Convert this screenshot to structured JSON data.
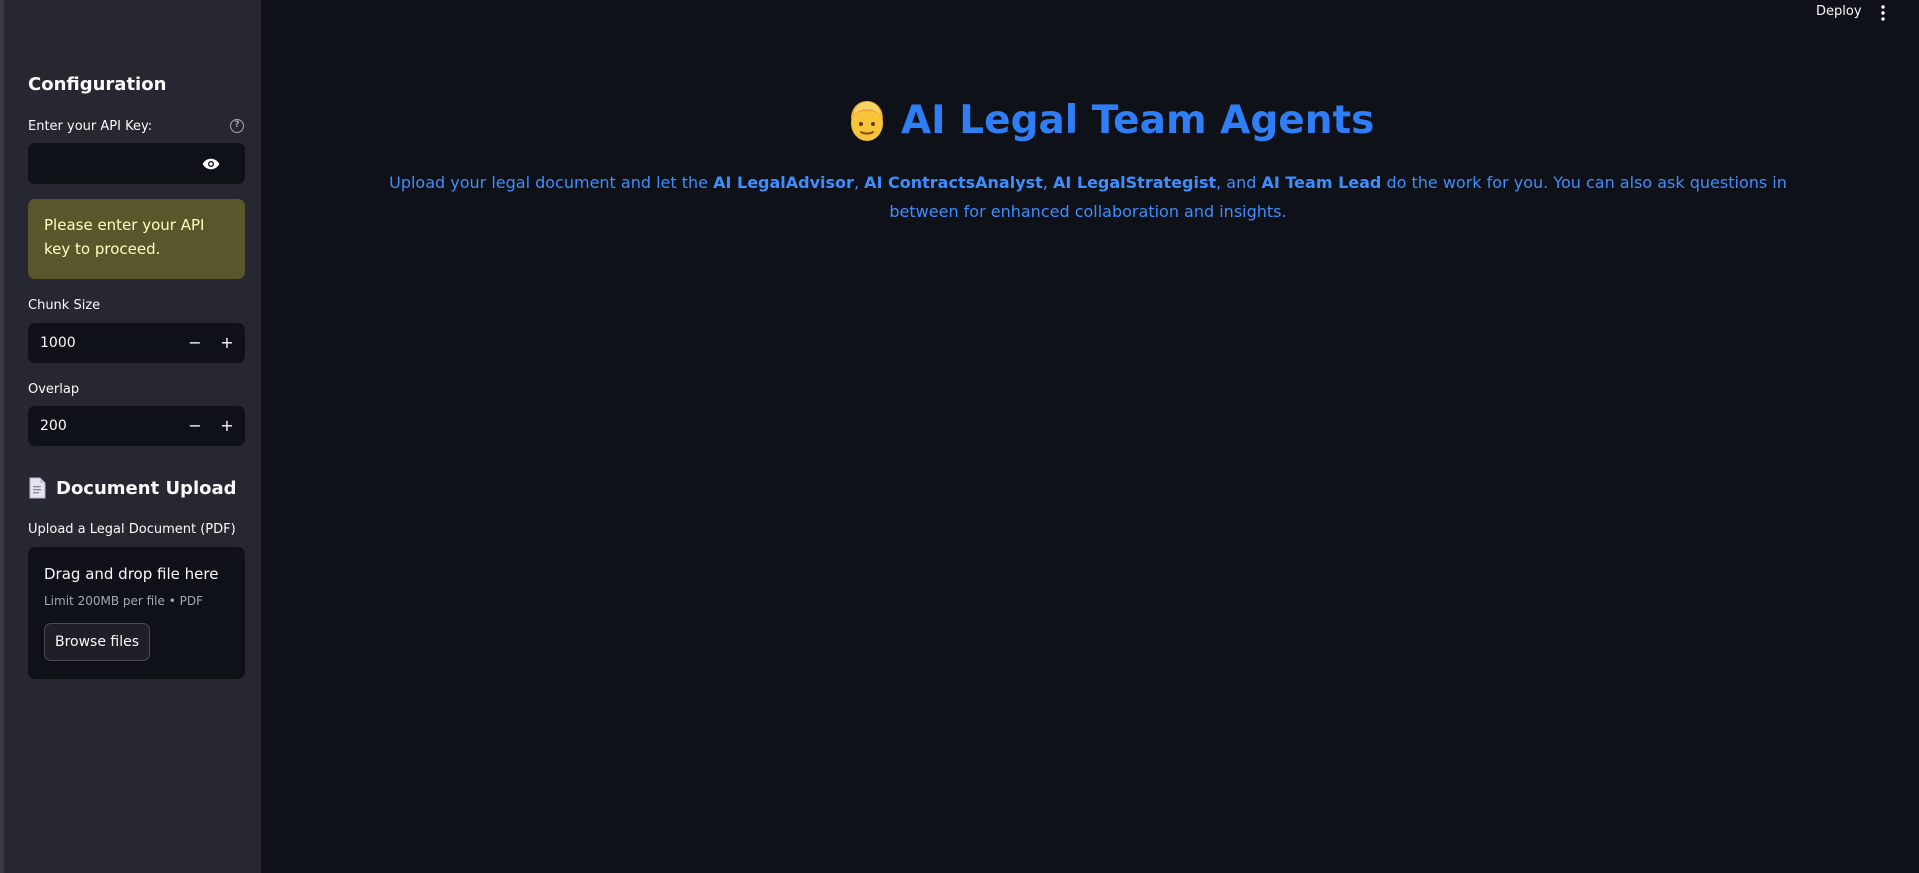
{
  "sidebar": {
    "title": "Configuration",
    "api_key": {
      "label": "Enter your API Key:",
      "value": "",
      "placeholder": ""
    },
    "warning": "Please enter your API key to proceed.",
    "chunk_size": {
      "label": "Chunk Size",
      "value": "1000"
    },
    "overlap": {
      "label": "Overlap",
      "value": "200"
    },
    "upload": {
      "heading": "Document Upload",
      "label": "Upload a Legal Document (PDF)",
      "drop_text": "Drag and drop file here",
      "limit": "Limit 200MB per file • PDF",
      "browse_label": "Browse files"
    }
  },
  "header": {
    "deploy_label": "Deploy"
  },
  "main": {
    "title": "AI Legal Team Agents",
    "intro": {
      "p1": "Upload your legal document and let the ",
      "a1": "AI LegalAdvisor",
      "s1": ", ",
      "a2": "AI ContractsAnalyst",
      "s2": ", ",
      "a3": "AI LegalStrategist",
      "s3": ", and ",
      "a4": "AI Team Lead",
      "p2": " do the work for you. You can also ask questions in between for enhanced collaboration and insights."
    }
  },
  "colors": {
    "accent": "#2f7ef7",
    "warning_bg": "#59562b",
    "warning_text": "#ffffc2",
    "sidebar_bg": "#262730",
    "main_bg": "#0e1117"
  }
}
